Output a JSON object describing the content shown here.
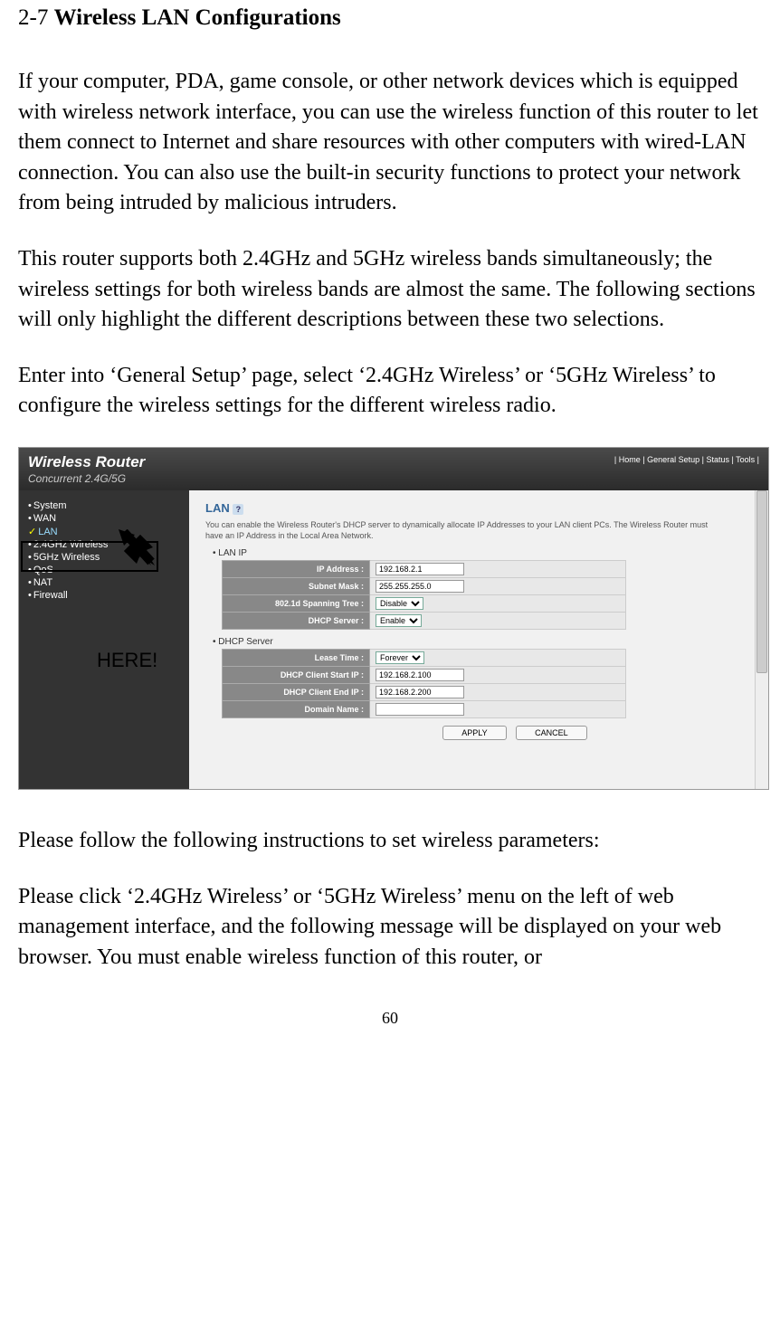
{
  "heading_prefix": "2-7 ",
  "heading_bold": "Wireless LAN Configurations",
  "paragraphs": {
    "p1": "If your computer, PDA, game console, or other network devices which is equipped with wireless network interface, you can use the wireless function of this router to let them connect to Internet and share resources with other computers with wired-LAN connection. You can also use the built-in security functions to protect your network from being intruded by malicious intruders.",
    "p2": "This router supports both 2.4GHz and 5GHz wireless bands simultaneously; the wireless settings for both wireless bands are almost the same. The following sections will only highlight the different descriptions between these two selections.",
    "p3": "Enter into ‘General Setup’ page, select ‘2.4GHz Wireless’ or ‘5GHz Wireless’ to configure the wireless settings for the different wireless radio.",
    "p4": "Please follow the following instructions to set wireless parameters:",
    "p5": "Please click ‘2.4GHz Wireless’ or ‘5GHz Wireless’ menu on the left of web management interface, and the following message will be displayed on your web browser. You must enable wireless function of this router, or"
  },
  "router": {
    "title": "Wireless Router",
    "subtitle": "Concurrent 2.4G/5G",
    "nav": "| Home | General Setup | Status | Tools |",
    "sidebar": [
      "System",
      "WAN",
      "LAN",
      "2.4GHz Wireless",
      "5GHz Wireless",
      "QoS",
      "NAT",
      "Firewall"
    ],
    "here_label": "HERE!",
    "content": {
      "title": "LAN",
      "desc": "You can enable the Wireless Router's DHCP server to dynamically allocate IP Addresses to your LAN client PCs. The Wireless Router must have an IP Address in the Local Area Network.",
      "lan_ip_label": "•  LAN IP",
      "dhcp_label": "•  DHCP Server",
      "fields": {
        "ip_address_label": "IP Address :",
        "ip_address_value": "192.168.2.1",
        "subnet_label": "Subnet Mask :",
        "subnet_value": "255.255.255.0",
        "spanning_label": "802.1d Spanning Tree :",
        "spanning_value": "Disable",
        "dhcp_server_label": "DHCP Server :",
        "dhcp_server_value": "Enable",
        "lease_label": "Lease Time :",
        "lease_value": "Forever",
        "start_ip_label": "DHCP Client Start IP :",
        "start_ip_value": "192.168.2.100",
        "end_ip_label": "DHCP Client End IP :",
        "end_ip_value": "192.168.2.200",
        "domain_label": "Domain Name :",
        "domain_value": ""
      },
      "apply_btn": "APPLY",
      "cancel_btn": "CANCEL"
    }
  },
  "page_number": "60"
}
